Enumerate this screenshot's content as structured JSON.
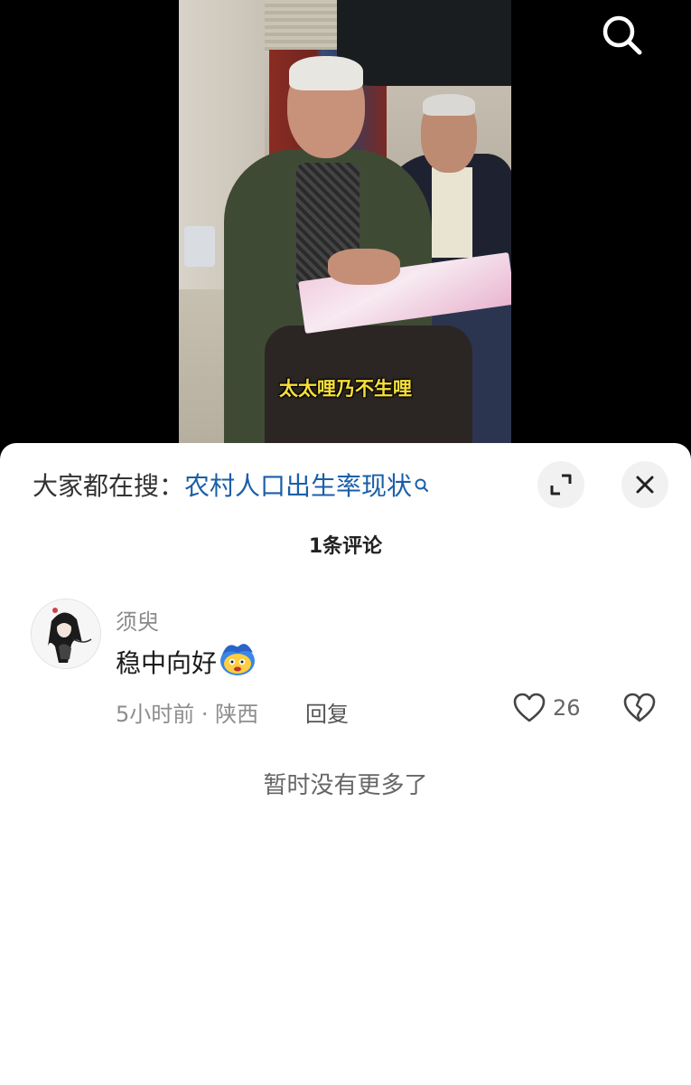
{
  "video": {
    "subtitle": "太太哩乃不生哩"
  },
  "header": {
    "search_icon": "search-icon"
  },
  "sheet": {
    "trending_prefix": "大家都在搜：",
    "trending_query": "农村人口出生率现状",
    "expand_icon": "expand-icon",
    "close_icon": "close-icon",
    "comment_count_label": "1条评论",
    "comments": [
      {
        "username": "须臾",
        "text": "稳中向好",
        "emoji": "flustered-face-emoji",
        "meta": "5小时前 · 陕西",
        "reply_label": "回复",
        "likes": "26"
      }
    ],
    "end_label": "暂时没有更多了"
  },
  "colors": {
    "link": "#1a5fa8",
    "subtitle": "#f7df3a",
    "sheet_bg": "#ffffff"
  }
}
